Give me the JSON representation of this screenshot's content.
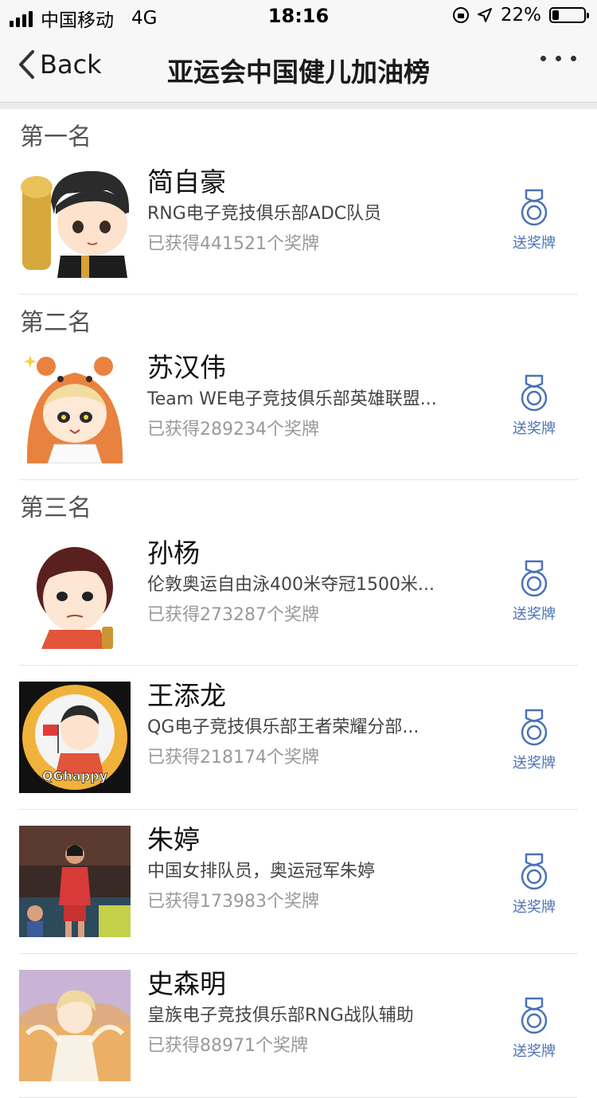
{
  "status_bar": {
    "carrier": "中国移动",
    "network": "4G",
    "time": "18:16",
    "battery": "22%",
    "battery_level": 0.22
  },
  "nav": {
    "back_label": "Back",
    "title": "亚运会中国健儿加油榜"
  },
  "colors": {
    "accent": "#4a72b8",
    "secondary_text": "#999999"
  },
  "ranking": [
    {
      "rank_label": "第一名",
      "name": "简自豪",
      "desc": "RNG电子竞技俱乐部ADC队员",
      "count": "已获得441521个奖牌",
      "action": "送奖牌"
    },
    {
      "rank_label": "第二名",
      "name": "苏汉伟",
      "desc": "Team WE电子竞技俱乐部英雄联盟...",
      "count": "已获得289234个奖牌",
      "action": "送奖牌"
    },
    {
      "rank_label": "第三名",
      "name": "孙杨",
      "desc": "伦敦奥运自由泳400米夺冠1500米...",
      "count": "已获得273287个奖牌",
      "action": "送奖牌"
    },
    {
      "name": "王添龙",
      "desc": "QG电子竞技俱乐部王者荣耀分部...",
      "count": "已获得218174个奖牌",
      "action": "送奖牌",
      "avatar_text": "QGhappy"
    },
    {
      "name": "朱婷",
      "desc": "中国女排队员，奥运冠军朱婷",
      "count": "已获得173983个奖牌",
      "action": "送奖牌"
    },
    {
      "name": "史森明",
      "desc": "皇族电子竞技俱乐部RNG战队辅助",
      "count": "已获得88971个奖牌",
      "action": "送奖牌"
    }
  ]
}
